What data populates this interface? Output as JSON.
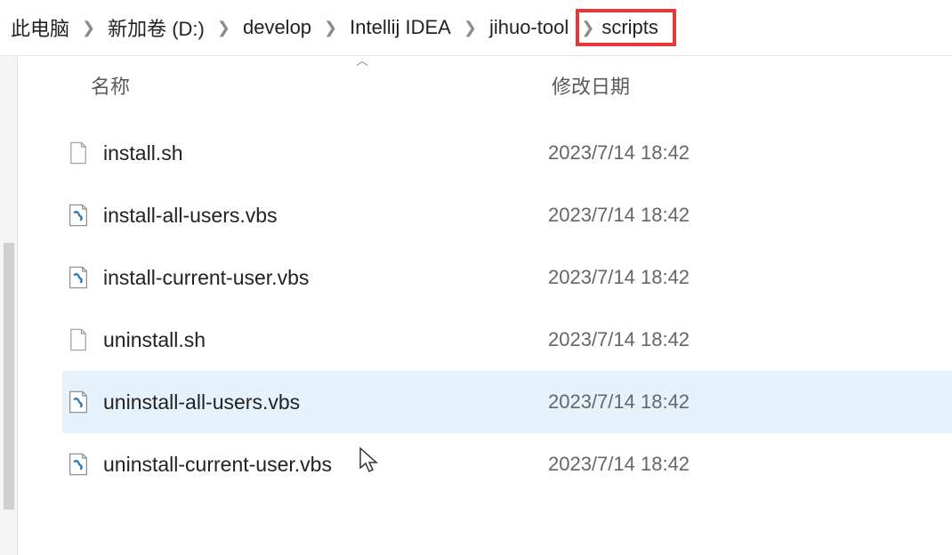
{
  "breadcrumb": {
    "items": [
      {
        "label": "此电脑"
      },
      {
        "label": "新加卷 (D:)"
      },
      {
        "label": "develop"
      },
      {
        "label": "Intellij IDEA"
      },
      {
        "label": "jihuo-tool"
      },
      {
        "label": "scripts",
        "highlighted": true
      }
    ]
  },
  "columns": {
    "name": "名称",
    "date": "修改日期"
  },
  "files": [
    {
      "name": "install.sh",
      "date": "2023/7/14 18:42",
      "icon": "file",
      "selected": false
    },
    {
      "name": "install-all-users.vbs",
      "date": "2023/7/14 18:42",
      "icon": "vbs",
      "selected": false
    },
    {
      "name": "install-current-user.vbs",
      "date": "2023/7/14 18:42",
      "icon": "vbs",
      "selected": false
    },
    {
      "name": "uninstall.sh",
      "date": "2023/7/14 18:42",
      "icon": "file",
      "selected": false
    },
    {
      "name": "uninstall-all-users.vbs",
      "date": "2023/7/14 18:42",
      "icon": "vbs",
      "selected": true
    },
    {
      "name": "uninstall-current-user.vbs",
      "date": "2023/7/14 18:42",
      "icon": "vbs",
      "selected": false
    }
  ]
}
